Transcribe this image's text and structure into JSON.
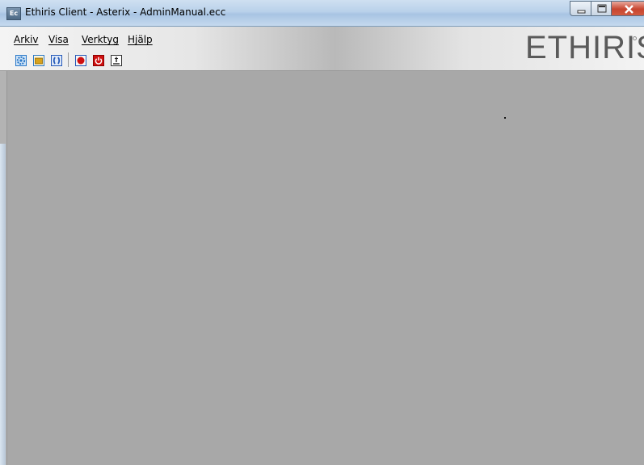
{
  "window": {
    "app_icon_text": "Ec",
    "title": "Ethiris Client - Asterix - AdminManual.ecc"
  },
  "window_controls": {
    "minimize_icon": "minimize-icon",
    "maximize_icon": "maximize-icon",
    "close_icon": "close-icon"
  },
  "menu": {
    "items": [
      {
        "label": "Arkiv"
      },
      {
        "label": "Visa"
      },
      {
        "label": "Verktyg"
      },
      {
        "label": "Hjälp"
      }
    ]
  },
  "brand": {
    "logo_text": "ETHIRIS"
  },
  "toolbar": {
    "buttons": [
      {
        "icon": "settings-gear-icon",
        "color": "#2a78c8"
      },
      {
        "icon": "folder-open-icon",
        "color": "#d8a21c"
      },
      {
        "icon": "refresh-brackets-icon",
        "color": "#2458b8"
      },
      {
        "icon": "record-icon",
        "color": "#d01010"
      },
      {
        "icon": "power-icon",
        "color": "#d01010"
      },
      {
        "icon": "export-arrow-icon",
        "color": "#222222"
      }
    ]
  },
  "colors": {
    "workspace_bg": "#a8a8a8",
    "title_bar": "#b9d1ea",
    "close_button": "#c7452f"
  }
}
